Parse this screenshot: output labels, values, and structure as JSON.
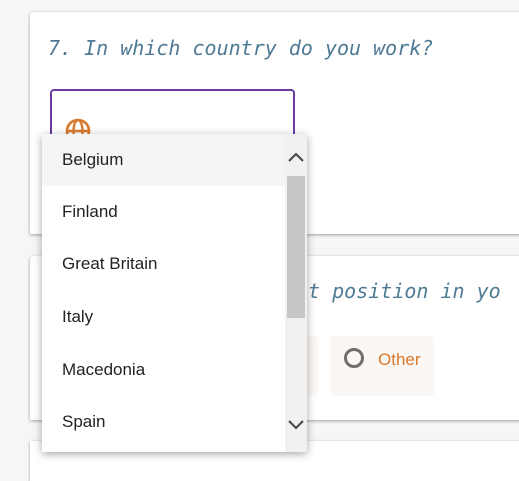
{
  "questions": {
    "q7": {
      "text": "7. In which country do you work?",
      "select": {
        "icon": "globe-icon"
      }
    },
    "q8": {
      "text_visible": "nt position in yo",
      "other_label": "Other"
    }
  },
  "dropdown": {
    "options": [
      "Belgium",
      "Finland",
      "Great Britain",
      "Italy",
      "Macedonia",
      "Spain"
    ],
    "highlighted": "Belgium"
  },
  "colors": {
    "question_text": "#4f7a94",
    "select_border": "#6a3aa2",
    "accent_orange": "#d9792c"
  }
}
